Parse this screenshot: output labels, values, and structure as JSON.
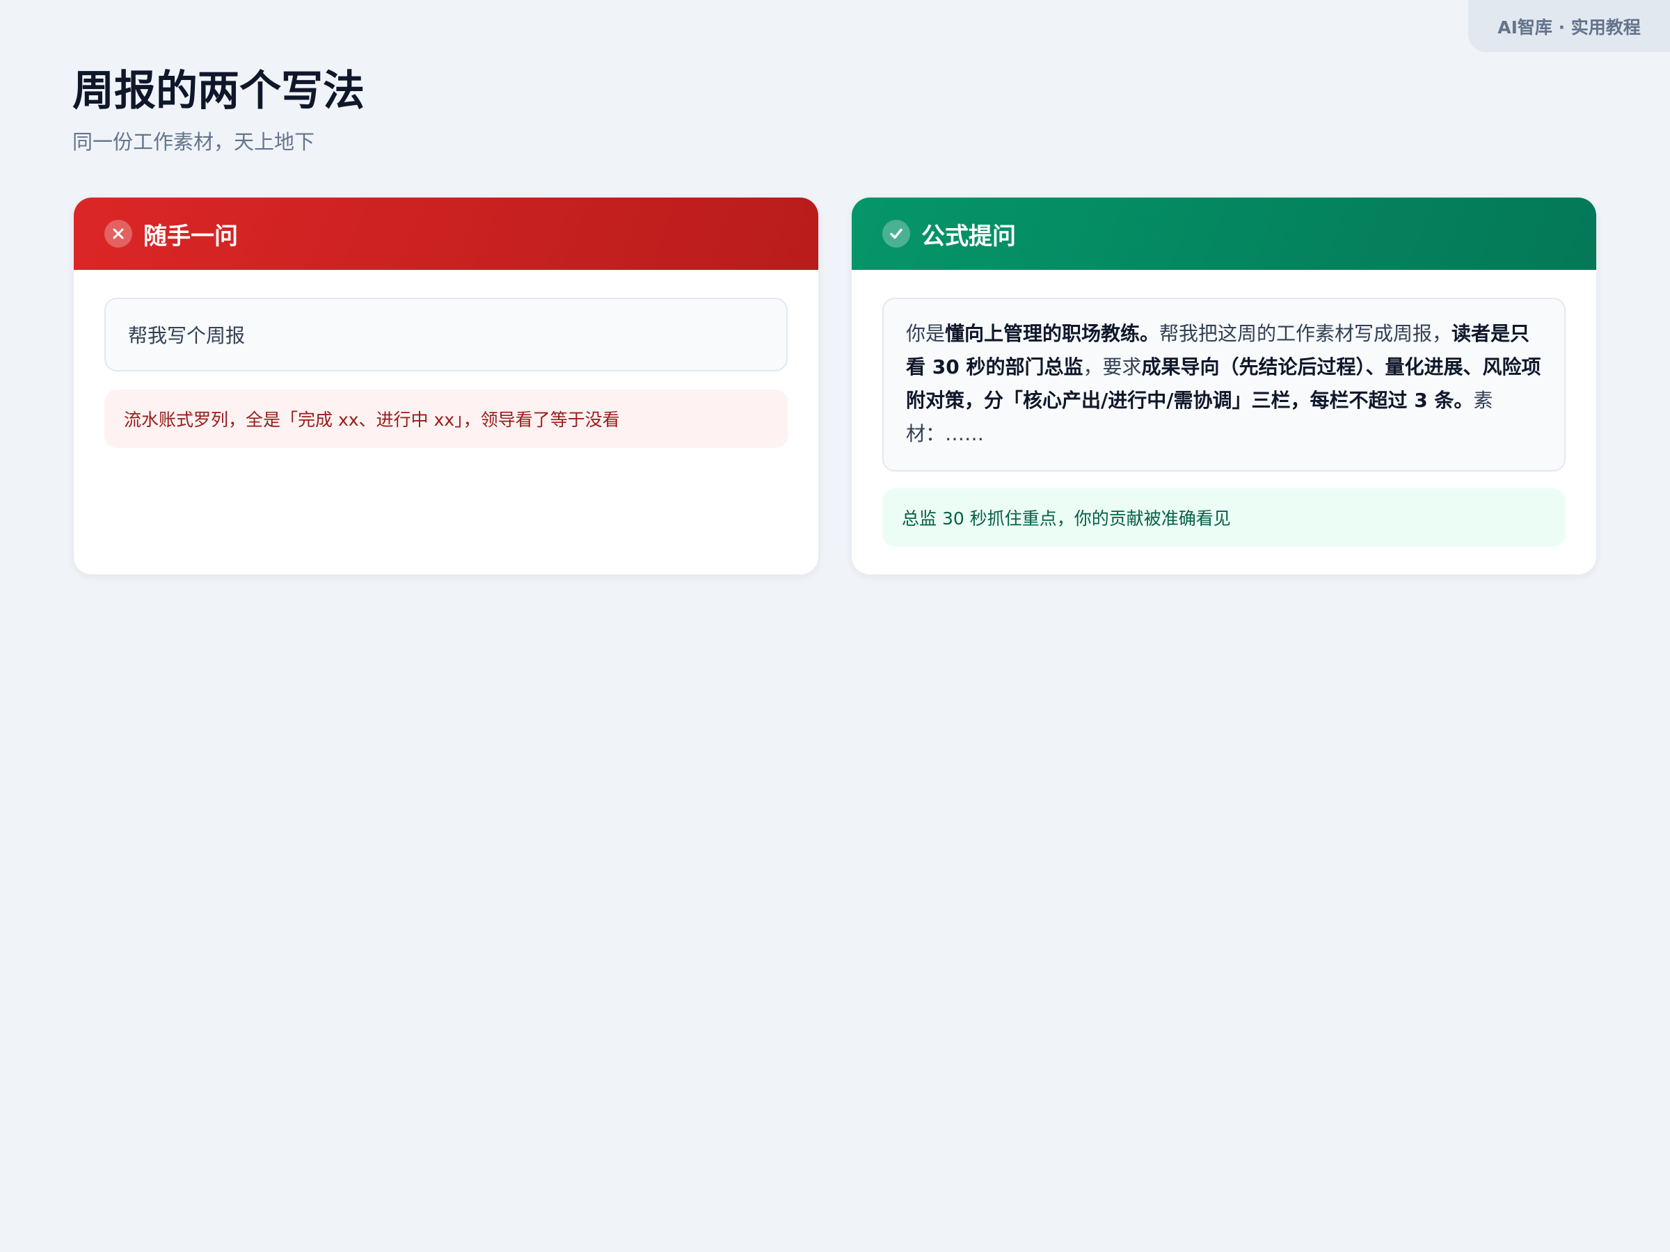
{
  "brand_tag": "AI智库 · 实用教程",
  "title": "周报的两个写法",
  "subtitle": "同一份工作素材，天上地下",
  "cards": {
    "bad": {
      "title": "随手一问",
      "icon": "x-icon",
      "accent": "#dc2626",
      "prompt": "帮我写个周报",
      "verdict": "流水账式罗列，全是「完成 xx、进行中 xx」，领导看了等于没看"
    },
    "good": {
      "title": "公式提问",
      "icon": "check-icon",
      "accent": "#059669",
      "prompt_parts": {
        "p1": "你是",
        "b1": "懂向上管理的职场教练。",
        "p2": "帮我把这周的工作素材写成周报，",
        "b2": "读者是只看 30 秒的部门总监",
        "p3": "，要求",
        "b3": "成果导向（先结论后过程）、量化进展、风险项附对策，分「核心产出/进行中/需协调」三栏，每栏不超过 3 条。",
        "p4": "素材：……"
      },
      "verdict": "总监 30 秒抓住重点，你的贡献被准确看见"
    }
  }
}
